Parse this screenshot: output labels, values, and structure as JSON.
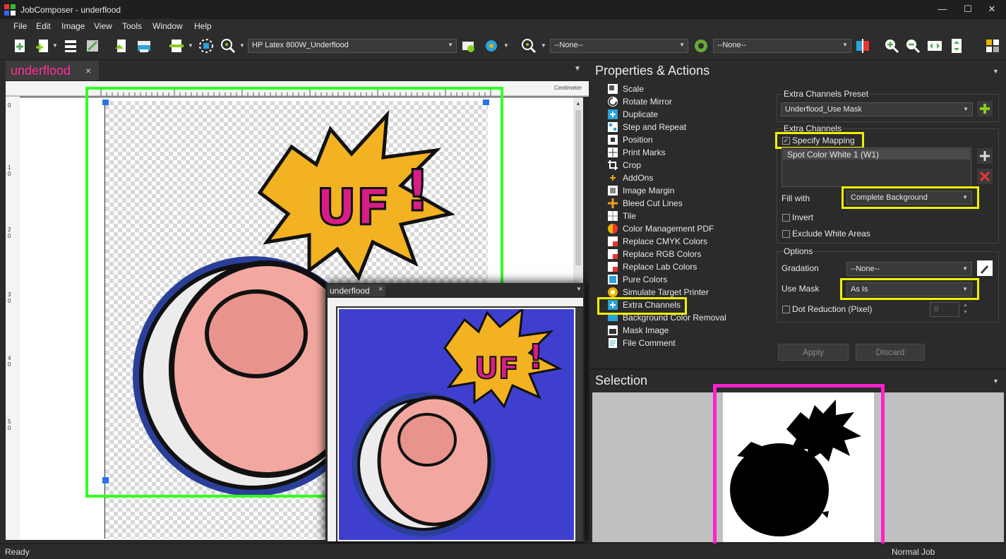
{
  "window": {
    "title": "JobComposer - underflood",
    "minimize": "—",
    "maximize": "☐",
    "close": "✕"
  },
  "menu": [
    "File",
    "Edit",
    "Image",
    "View",
    "Tools",
    "Window",
    "Help"
  ],
  "toolbar": {
    "printer_combo": "HP Latex 800W_Underflood",
    "combo_2": "--None--",
    "combo_3": "--None--"
  },
  "doc_tab": {
    "label": "underflood",
    "close": "×"
  },
  "preview_tab": {
    "label": "underflood",
    "close": "×"
  },
  "ruler": {
    "unit": "Centimeter",
    "vlabels": [
      "0",
      "1 0",
      "2 0",
      "3 0",
      "4 0",
      "5 0"
    ]
  },
  "properties": {
    "title": "Properties & Actions",
    "actions": [
      {
        "label": "Scale",
        "icon": "scale-icon"
      },
      {
        "label": "Rotate Mirror",
        "icon": "rotate-icon"
      },
      {
        "label": "Duplicate",
        "icon": "duplicate-icon"
      },
      {
        "label": "Step and Repeat",
        "icon": "step-repeat-icon"
      },
      {
        "label": "Position",
        "icon": "position-icon"
      },
      {
        "label": "Print Marks",
        "icon": "print-marks-icon"
      },
      {
        "label": "Crop",
        "icon": "crop-icon"
      },
      {
        "label": "AddOns",
        "icon": "addons-icon"
      },
      {
        "label": "Image Margin",
        "icon": "image-margin-icon"
      },
      {
        "label": "Bleed Cut Lines",
        "icon": "bleed-icon"
      },
      {
        "label": "Tile",
        "icon": "tile-icon"
      },
      {
        "label": "Color Management PDF",
        "icon": "color-management-icon"
      },
      {
        "label": "Replace CMYK Colors",
        "icon": "replace-cmyk-icon"
      },
      {
        "label": "Replace RGB Colors",
        "icon": "replace-rgb-icon"
      },
      {
        "label": "Replace Lab Colors",
        "icon": "replace-lab-icon"
      },
      {
        "label": "Pure Colors",
        "icon": "pure-colors-icon"
      },
      {
        "label": "Simulate Target Printer",
        "icon": "simulate-printer-icon"
      },
      {
        "label": "Extra Channels",
        "icon": "extra-channels-icon"
      },
      {
        "label": "Background Color Removal",
        "icon": "background-removal-icon"
      },
      {
        "label": "Mask Image",
        "icon": "mask-image-icon"
      },
      {
        "label": "File Comment",
        "icon": "file-comment-icon"
      }
    ],
    "preset_group": "Extra Channels Preset",
    "preset_value": "Underflood_Use Mask",
    "channels_group": "Extra Channels",
    "specify_mapping": "Specify Mapping",
    "channel_item": "Spot Color White 1 (W1)",
    "fill_with_label": "Fill with",
    "fill_with_value": "Complete Background",
    "invert": "Invert",
    "exclude_white": "Exclude White Areas",
    "options_group": "Options",
    "gradation_label": "Gradation",
    "gradation_value": "--None--",
    "use_mask_label": "Use Mask",
    "use_mask_value": "As Is",
    "dot_reduction": "Dot Reduction (Pixel)",
    "dot_value": "0",
    "apply": "Apply",
    "discard": "Discard"
  },
  "selection": {
    "title": "Selection"
  },
  "status": {
    "left": "Ready",
    "right": "Normal Job"
  },
  "art": {
    "text": "UF",
    "bang": "!"
  },
  "colors": {
    "highlight_yellow": "#f0f000",
    "highlight_green": "#33ff22",
    "highlight_magenta": "#ff22cc",
    "preview_bg": "#3f3fcf",
    "accent_pink": "#ff2e9a"
  }
}
